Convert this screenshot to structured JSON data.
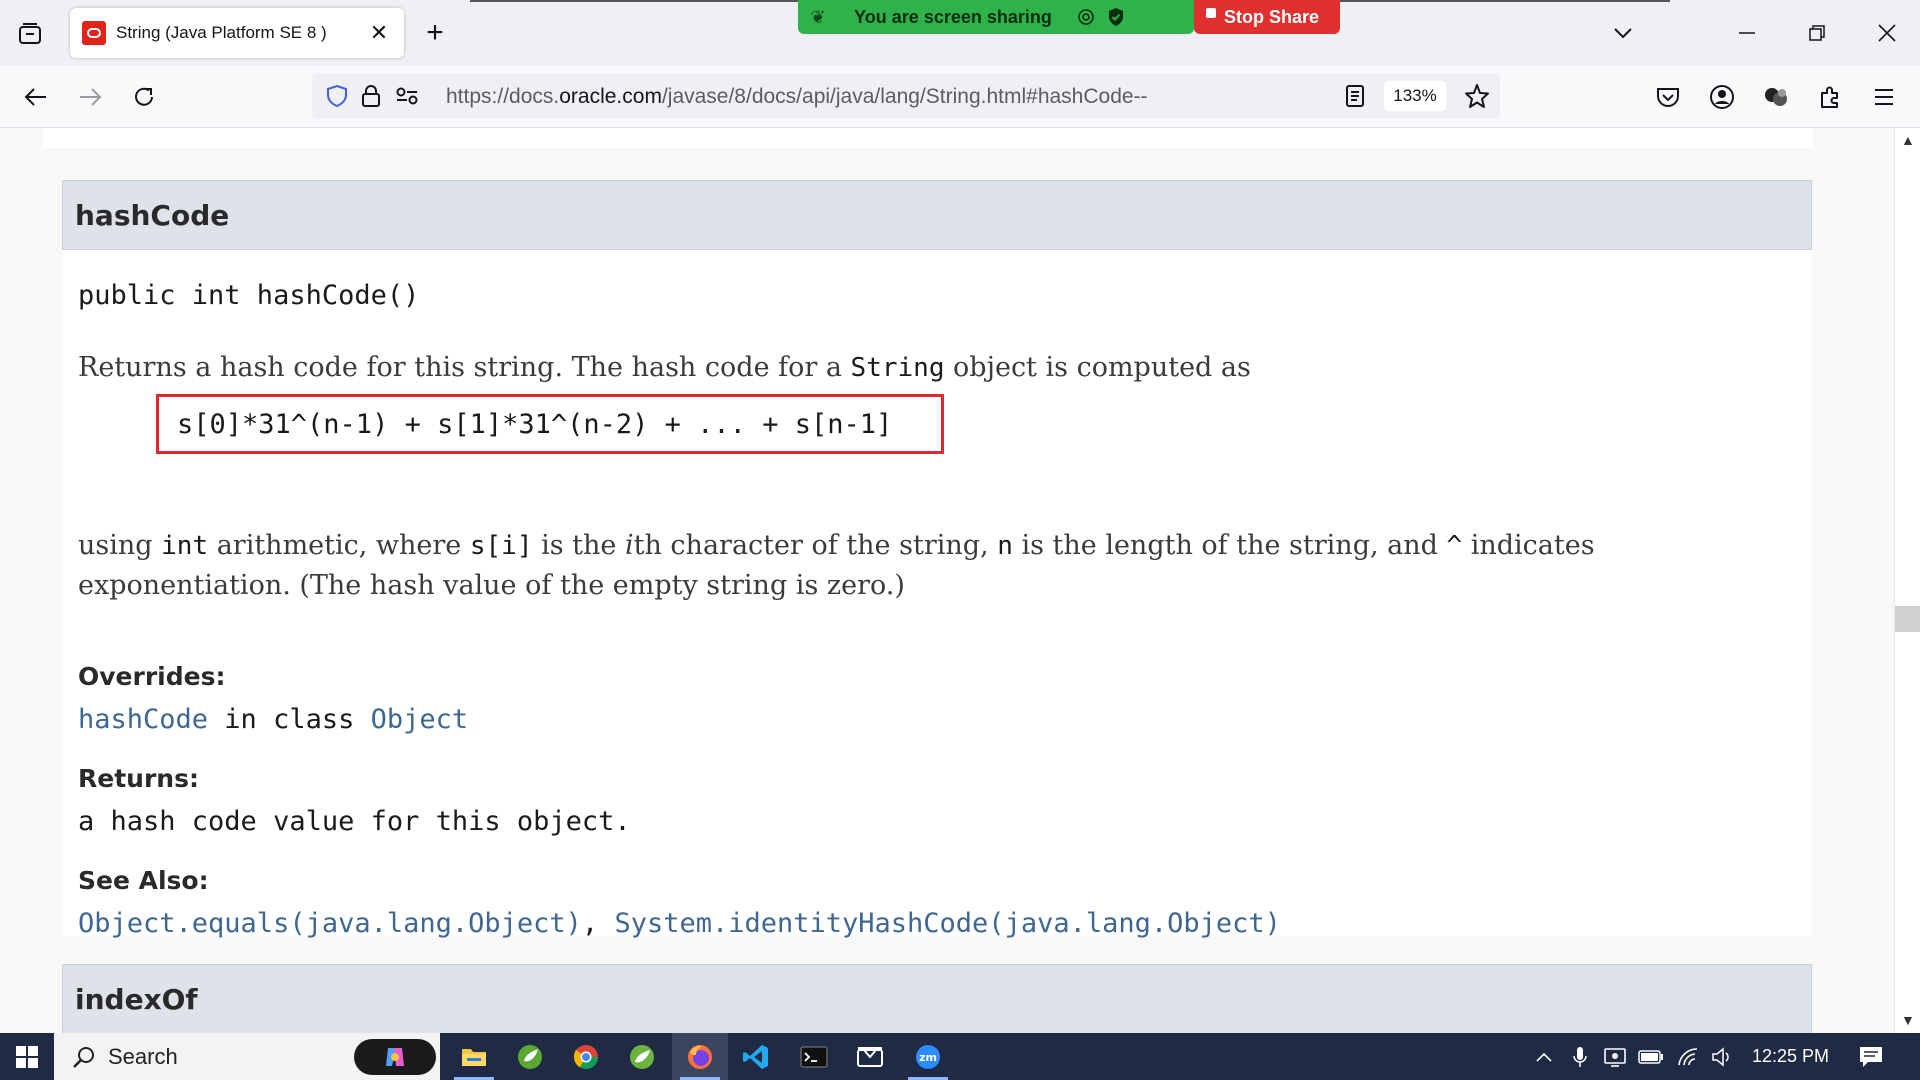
{
  "browser": {
    "tab_title": "String (Java Platform SE 8 )",
    "new_tab": "+",
    "url_prefix": "https://docs.",
    "url_domain": "oracle.com",
    "url_path": "/javase/8/docs/api/java/lang/String.html#hashCode--",
    "zoom": "133%"
  },
  "screen_share": {
    "status_text": "You are screen sharing",
    "stop_label": "Stop Share",
    "bar_color": "#2fb24a",
    "stop_color": "#e02f2f"
  },
  "doc": {
    "method_name": "hashCode",
    "signature": "public int hashCode()",
    "desc1_pre": "Returns a hash code for this string. The hash code for a ",
    "desc1_code": "String",
    "desc1_post": " object is computed as",
    "formula": "s[0]*31^(n-1) + s[1]*31^(n-2) + ... + s[n-1]",
    "desc2_a": "using ",
    "desc2_code1": "int",
    "desc2_b": " arithmetic, where ",
    "desc2_code2": "s[i]",
    "desc2_c": " is the ",
    "desc2_italic": "i",
    "desc2_d": "th character of the string, ",
    "desc2_code3": "n",
    "desc2_e": " is the length of the string, and ",
    "desc2_code4": "^",
    "desc2_f": " indicates exponentiation. (The hash value of the empty string is zero.)",
    "overrides_label": "Overrides:",
    "overrides_method": "hashCode",
    "overrides_mid": " in class ",
    "overrides_class": "Object",
    "returns_label": "Returns:",
    "returns_text": "a hash code value for this object.",
    "see_also_label": "See Also:",
    "see_also_1": "Object.equals(java.lang.Object)",
    "see_also_sep": ", ",
    "see_also_2": "System.identityHashCode(java.lang.Object)",
    "next_method": "indexOf",
    "link_color": "#3e6793",
    "highlight_color": "#e0282e"
  },
  "taskbar": {
    "search_label": "Search",
    "time": "12:25 PM"
  }
}
